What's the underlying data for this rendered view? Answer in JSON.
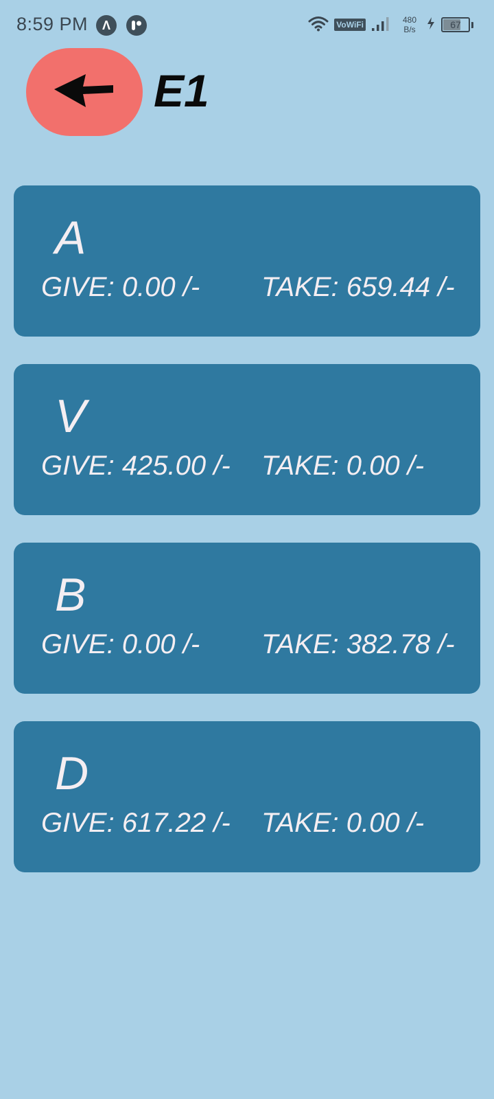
{
  "status_bar": {
    "time": "8:59 PM",
    "app_icon_1": "Λ",
    "app_icon_2": "P",
    "vowifi": "VoWiFi",
    "speed_value": "480",
    "speed_unit": "B/s",
    "battery_level": "67",
    "battery_fraction": 0.67,
    "icons": [
      "wifi-icon",
      "signal-icon",
      "charging-icon",
      "battery-icon"
    ]
  },
  "header": {
    "title": "E1",
    "back_icon": "arrow-left-icon"
  },
  "colors": {
    "background": "#a9d0e6",
    "card": "#2f79a0",
    "back_button": "#f2706c",
    "card_text": "#f4eef2"
  },
  "cards": [
    {
      "name": "A",
      "give": "GIVE: 0.00 /-",
      "take": "TAKE: 659.44 /-"
    },
    {
      "name": "V",
      "give": "GIVE: 425.00 /-",
      "take": "TAKE: 0.00 /-"
    },
    {
      "name": "B",
      "give": "GIVE: 0.00 /-",
      "take": "TAKE: 382.78 /-"
    },
    {
      "name": "D",
      "give": "GIVE: 617.22 /-",
      "take": "TAKE: 0.00 /-"
    }
  ]
}
